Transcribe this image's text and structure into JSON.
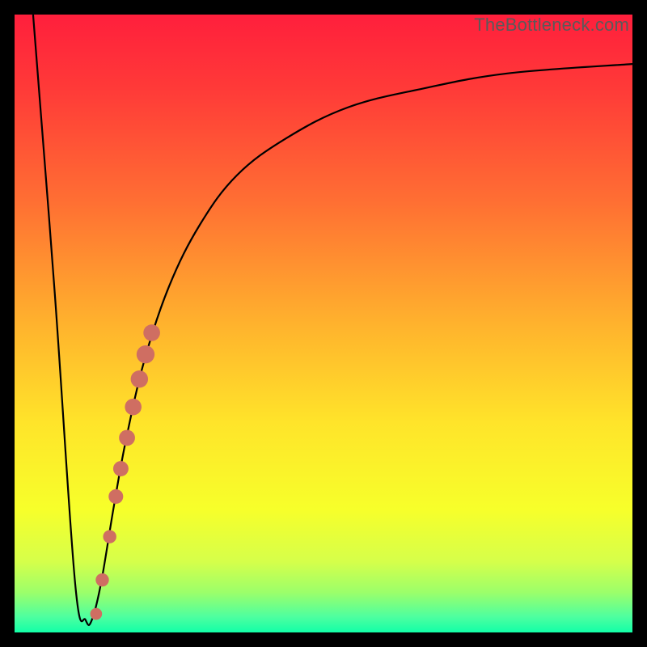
{
  "watermark": "TheBottleneck.com",
  "colors": {
    "frame": "#000000",
    "curve": "#000000",
    "dot": "#cf6e62",
    "gradient_stops": [
      {
        "offset": 0.0,
        "color": "#ff1f3c"
      },
      {
        "offset": 0.12,
        "color": "#ff3a38"
      },
      {
        "offset": 0.3,
        "color": "#ff6e33"
      },
      {
        "offset": 0.5,
        "color": "#ffb22d"
      },
      {
        "offset": 0.66,
        "color": "#ffe42a"
      },
      {
        "offset": 0.8,
        "color": "#f7ff2a"
      },
      {
        "offset": 0.885,
        "color": "#d6ff4a"
      },
      {
        "offset": 0.935,
        "color": "#9cff6a"
      },
      {
        "offset": 0.975,
        "color": "#4dffa0"
      },
      {
        "offset": 1.0,
        "color": "#12ffa7"
      }
    ]
  },
  "chart_data": {
    "type": "line",
    "title": "",
    "xlabel": "",
    "ylabel": "",
    "xlim": [
      0,
      100
    ],
    "ylim": [
      0,
      100
    ],
    "series": [
      {
        "name": "bottleneck-curve",
        "x": [
          3.0,
          6.5,
          9.8,
          11.5,
          12.5,
          14.0,
          16.0,
          18.0,
          21.0,
          25.0,
          30.0,
          36.0,
          44.0,
          54.0,
          66.0,
          80.0,
          100.0
        ],
        "y": [
          100,
          55,
          8,
          2,
          2,
          8,
          20,
          31,
          44,
          56,
          66,
          74,
          80,
          85,
          88,
          90.5,
          92
        ]
      }
    ],
    "dots": {
      "name": "highlight-dots",
      "points": [
        {
          "x": 13.2,
          "y": 3.0,
          "r": 0.8
        },
        {
          "x": 14.2,
          "y": 8.5,
          "r": 1.0
        },
        {
          "x": 15.4,
          "y": 15.5,
          "r": 1.0
        },
        {
          "x": 16.4,
          "y": 22.0,
          "r": 1.2
        },
        {
          "x": 17.2,
          "y": 26.5,
          "r": 1.3
        },
        {
          "x": 18.2,
          "y": 31.5,
          "r": 1.4
        },
        {
          "x": 19.2,
          "y": 36.5,
          "r": 1.5
        },
        {
          "x": 20.2,
          "y": 41.0,
          "r": 1.6
        },
        {
          "x": 21.2,
          "y": 45.0,
          "r": 1.7
        },
        {
          "x": 22.2,
          "y": 48.5,
          "r": 1.5
        }
      ]
    }
  }
}
